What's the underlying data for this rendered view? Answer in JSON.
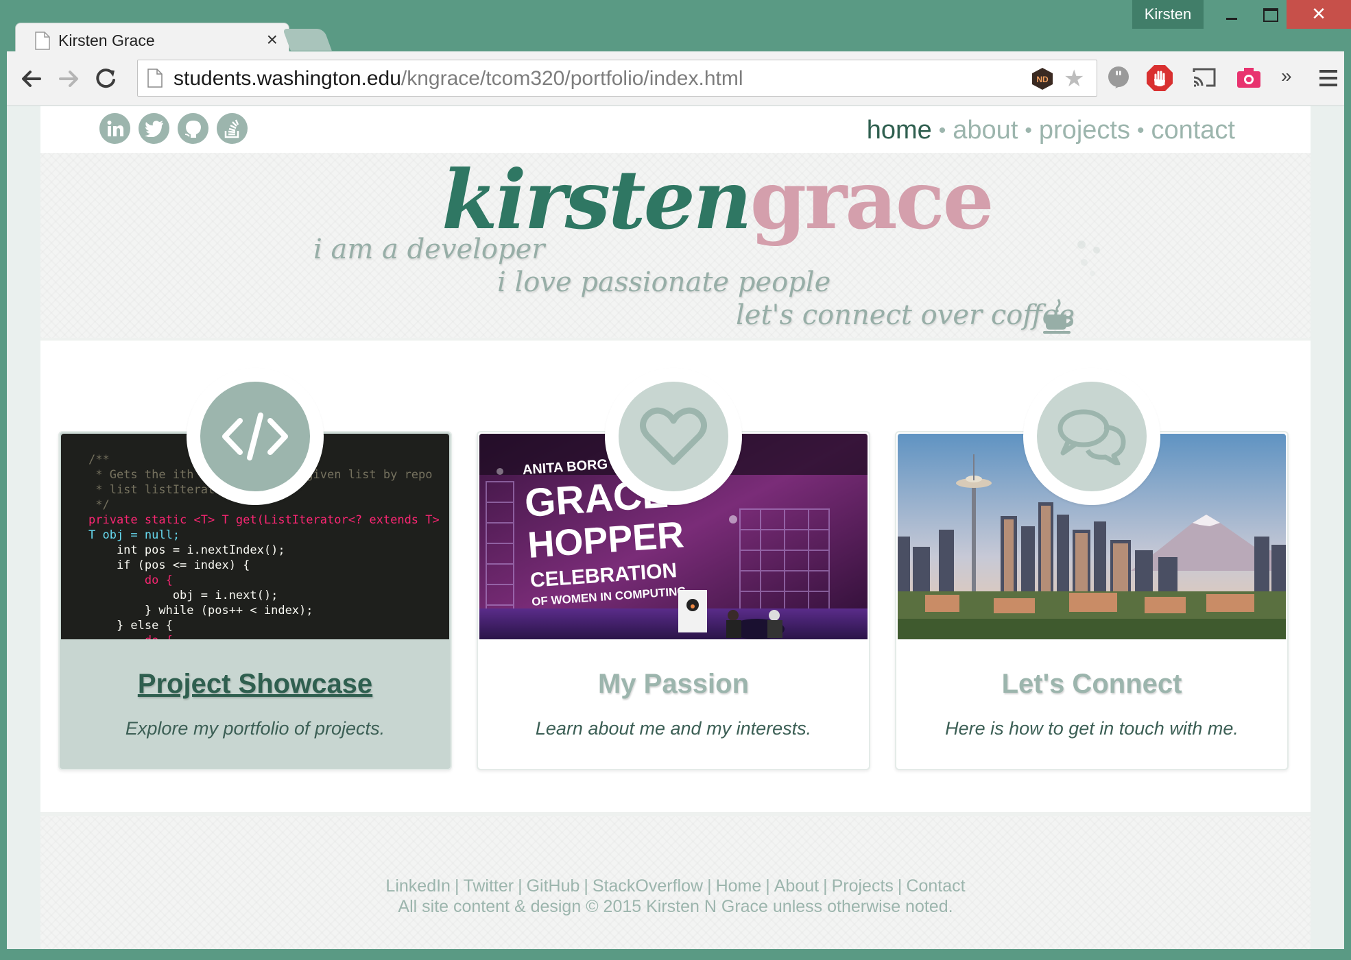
{
  "browser": {
    "tab_title": "Kirsten Grace",
    "tab_close": "×",
    "user_label": "Kirsten",
    "close_glyph": "✕",
    "url_host": "students.washington.edu",
    "url_path": "/kngrace/tcom320/portfolio/index.html",
    "extension_nd": "ND",
    "more_glyph": "»",
    "icons": [
      "back-arrow-icon",
      "forward-arrow-icon",
      "reload-icon",
      "page-icon",
      "nd-extension-icon",
      "star-icon",
      "quote-icon",
      "stop-hand-icon",
      "cast-icon",
      "camera-icon",
      "chevron-more-icon",
      "menu-icon"
    ]
  },
  "site": {
    "social": [
      "linkedin-icon",
      "twitter-icon",
      "github-icon",
      "stackoverflow-icon"
    ],
    "nav": {
      "home": "home",
      "about": "about",
      "projects": "projects",
      "contact": "contact",
      "separator": "•"
    },
    "logo_first": "kirsten",
    "logo_last": "grace",
    "taglines": [
      "i am a developer",
      "i love passionate people",
      "let's connect over coffee"
    ],
    "colors": {
      "accent_green": "#2f7763",
      "accent_pink": "#d49fac",
      "muted_green": "#9cb5ad",
      "dark_green": "#2f5f4f",
      "chrome_green": "#5a9a84"
    }
  },
  "cards": [
    {
      "title": "Project Showcase",
      "desc": "Explore my portfolio of projects.",
      "icon": "code-icon",
      "image": "code-editor-screenshot",
      "code": [
        "/**",
        " * Gets the ith              e given list by repo",
        " * list listIterat",
        " */",
        "private static <T> T get(ListIterator<? extends T>",
        "T obj = null;",
        "    int pos = i.nextIndex();",
        "    if (pos <= index) {",
        "        do {",
        "            obj = i.next();",
        "        } while (pos++ < index);",
        "    } else {",
        "        do {"
      ]
    },
    {
      "title": "My Passion",
      "desc": "Learn about me and my interests.",
      "icon": "heart-icon",
      "image": "grace-hopper-conference-stage",
      "stage_text": [
        "ANITA BORG IN",
        "GRACE",
        "HOPPER",
        "CELEBRATION",
        "OF WOMEN IN COMPUTING"
      ]
    },
    {
      "title": "Let's Connect",
      "desc": "Here is how to get in touch with me.",
      "icon": "chat-bubbles-icon",
      "image": "seattle-skyline-photo"
    }
  ],
  "footer": {
    "links": [
      "LinkedIn",
      "Twitter",
      "GitHub",
      "StackOverflow",
      "Home",
      "About",
      "Projects",
      "Contact"
    ],
    "separator": "|",
    "copyright": "All site content & design © 2015 Kirsten N Grace unless otherwise noted."
  }
}
